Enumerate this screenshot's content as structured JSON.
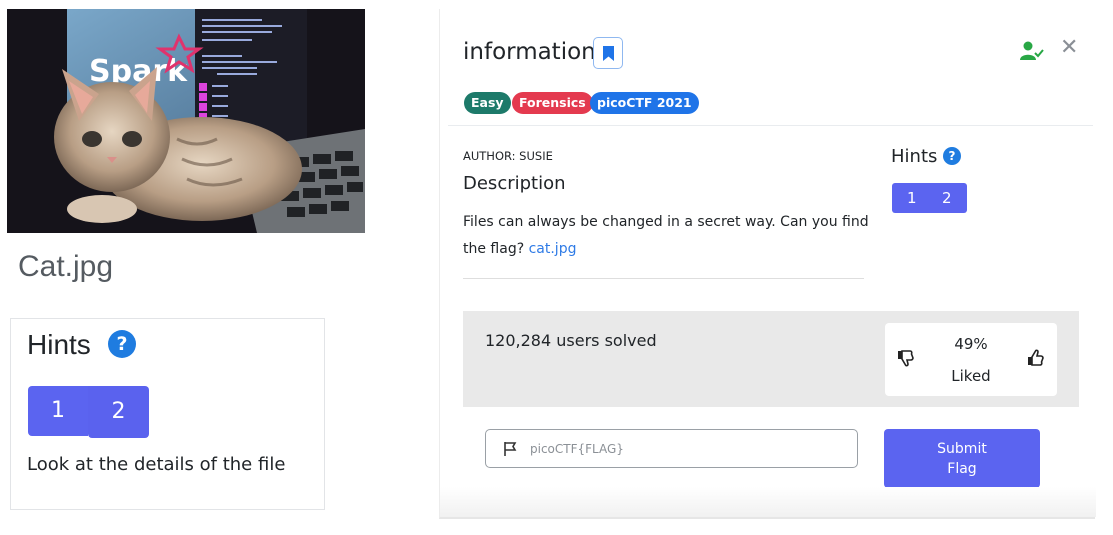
{
  "photo": {
    "screen_text": "Spark"
  },
  "left": {
    "caption": "Cat.jpg",
    "hints_title": "Hints",
    "help_glyph": "?",
    "hint_buttons": [
      "1",
      "2"
    ],
    "hint_text": "Look at the details of the file"
  },
  "challenge": {
    "title": "information",
    "tags": [
      "Easy",
      "Forensics",
      "picoCTF 2021"
    ],
    "author": "AUTHOR: SUSIE",
    "description_heading": "Description",
    "description_text": "Files can always be changed in a secret way. Can you find the flag?",
    "description_link": "cat.jpg",
    "hints_title": "Hints",
    "help_glyph": "?",
    "hint_buttons": [
      "1",
      "2"
    ],
    "close_glyph": "✕"
  },
  "stats": {
    "users_solved": "120,284 users solved",
    "liked_percent": "49%",
    "liked_label": "Liked"
  },
  "flag_form": {
    "placeholder": "picoCTF{FLAG}",
    "submit_line1": "Submit",
    "submit_line2": "Flag"
  },
  "icons": {
    "bookmark": "bookmark-icon",
    "solved": "user-check-icon",
    "close": "close-icon",
    "help": "question-circle-icon",
    "thumbs_down": "thumbs-down-icon",
    "thumbs_up": "thumbs-up-icon",
    "flag": "flag-icon"
  },
  "colors": {
    "accent": "#5b64f0",
    "tag_easy": "#1d7a6a",
    "tag_forensics": "#e43a4f",
    "tag_event": "#1f74e8",
    "help_blue": "#1f7ce0",
    "solved_green": "#28a745",
    "stats_band": "#e9e9e9"
  }
}
